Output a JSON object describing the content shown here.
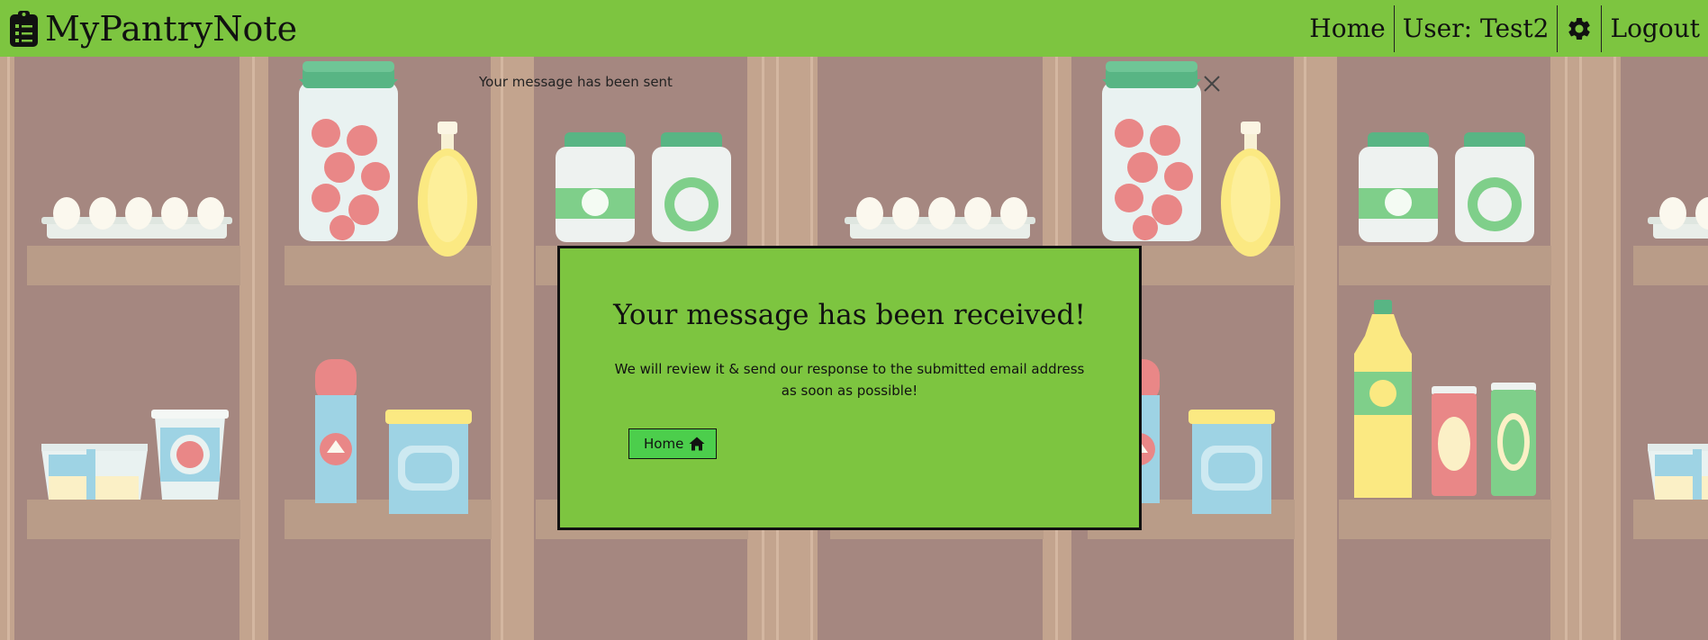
{
  "navbar": {
    "brand_icon": "clipboard-list-icon",
    "brand": "MyPantryNote",
    "links": {
      "home": "Home",
      "user": "User: Test2",
      "settings_icon": "gear-icon",
      "logout": "Logout"
    }
  },
  "toast": {
    "message": "Your message has been sent",
    "close_icon": "close-icon"
  },
  "modal": {
    "title": "Your message has been received!",
    "message": "We will review it & send our response to the submitted email address as soon as possible!",
    "home_button": "Home",
    "home_icon": "home-icon"
  },
  "colors": {
    "navbar": "#7dc540",
    "modal_bg": "#7dc540",
    "button_bg": "#4cce4c",
    "background": "#a58780"
  }
}
